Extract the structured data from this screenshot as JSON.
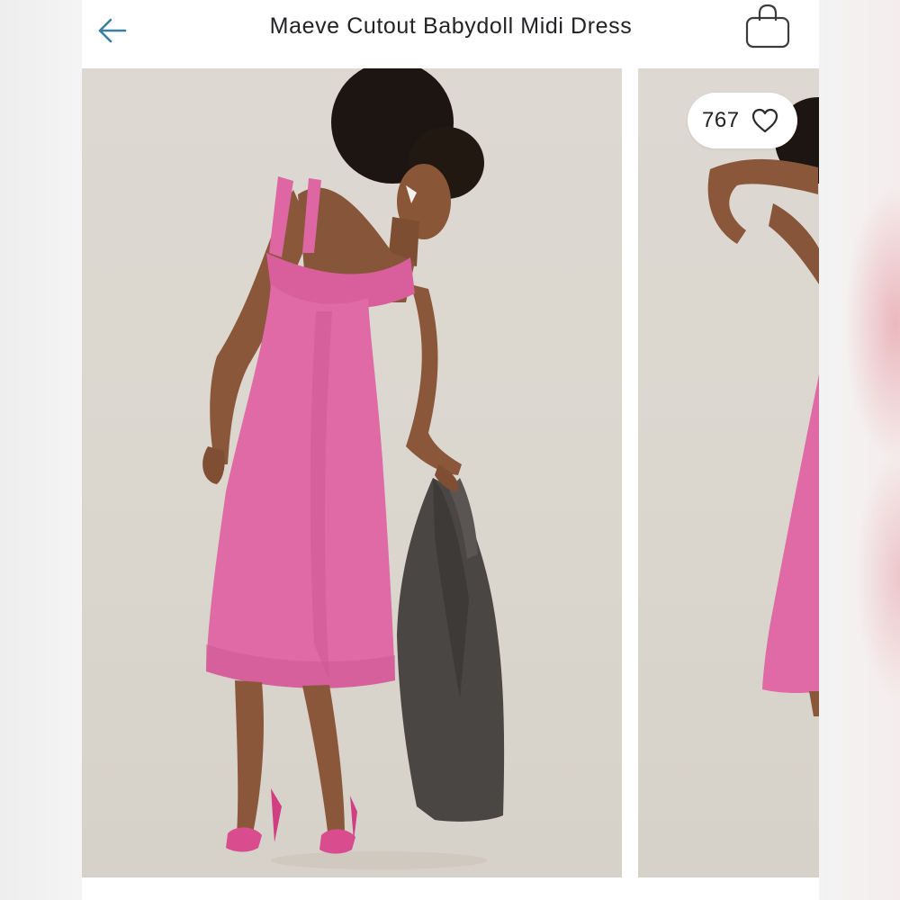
{
  "header": {
    "title": "Maeve Cutout Babydoll Midi Dress",
    "back_icon": "arrow-left-icon",
    "bag_icon": "shopping-bag-icon"
  },
  "gallery": {
    "images": [
      {
        "alt": "Model wearing pink sleeveless midi dress holding a grey blazer"
      },
      {
        "alt": "Second product photo, partially visible"
      }
    ],
    "likes": {
      "count": "767",
      "icon": "heart-outline-icon"
    }
  },
  "colors": {
    "accent": "#3a7f9e",
    "dress_pink": "#e06aa6",
    "backdrop": "#dcd8d0"
  }
}
